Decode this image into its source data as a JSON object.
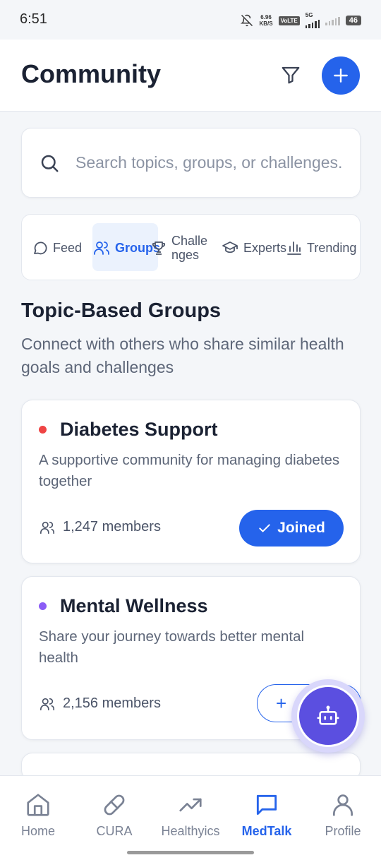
{
  "status_bar": {
    "time": "6:51",
    "net_speed_value": "6.96",
    "net_speed_unit": "KB/S",
    "volte": "VoLTE",
    "network": "5G",
    "battery": "46"
  },
  "header": {
    "title": "Community",
    "filter_icon": "filter-icon",
    "add_icon": "plus-icon"
  },
  "search": {
    "placeholder": "Search topics, groups, or challenges...",
    "value": ""
  },
  "tabs": [
    {
      "label": "Feed",
      "icon": "chat-bubble-icon",
      "active": false
    },
    {
      "label": "Groups",
      "icon": "users-icon",
      "active": true
    },
    {
      "label": "Challenges",
      "icon": "trophy-icon",
      "active": false
    },
    {
      "label": "Experts",
      "icon": "graduation-cap-icon",
      "active": false
    },
    {
      "label": "Trending",
      "icon": "bar-chart-icon",
      "active": false
    }
  ],
  "section": {
    "title": "Topic-Based Groups",
    "subtitle": "Connect with others who share similar health goals and challenges"
  },
  "groups": [
    {
      "name": "Diabetes Support",
      "description": "A supportive community for managing diabetes together",
      "members": "1,247 members",
      "button": "Joined",
      "joined": true,
      "color": "#ef4444"
    },
    {
      "name": "Mental Wellness",
      "description": "Share your journey towards better mental health",
      "members": "2,156 members",
      "button": "+",
      "joined": false,
      "color": "#8b5cf6"
    }
  ],
  "fab": {
    "icon": "robot-icon"
  },
  "bottom_nav": [
    {
      "label": "Home",
      "icon": "home-icon",
      "active": false
    },
    {
      "label": "CURA",
      "icon": "pill-icon",
      "active": false
    },
    {
      "label": "Healthyics",
      "icon": "trending-up-icon",
      "active": false
    },
    {
      "label": "MedTalk",
      "icon": "message-square-icon",
      "active": true
    },
    {
      "label": "Profile",
      "icon": "user-icon",
      "active": false
    }
  ],
  "colors": {
    "accent": "#2563eb",
    "fab": "#5b4fe0",
    "background": "#f4f6f9"
  }
}
